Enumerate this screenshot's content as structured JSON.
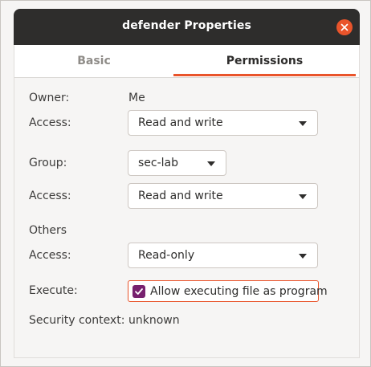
{
  "window": {
    "title": "defender Properties",
    "accent_color": "#e9542b",
    "titlebar_color": "#2e2d2c"
  },
  "tabs": [
    {
      "label": "Basic",
      "active": false
    },
    {
      "label": "Permissions",
      "active": true
    }
  ],
  "owner": {
    "label": "Owner:",
    "value": "Me",
    "access_label": "Access:",
    "access_value": "Read and write"
  },
  "group": {
    "label": "Group:",
    "value": "sec-lab",
    "access_label": "Access:",
    "access_value": "Read and write"
  },
  "others": {
    "heading": "Others",
    "access_label": "Access:",
    "access_value": "Read-only"
  },
  "execute": {
    "label": "Execute:",
    "checkbox_label": "Allow executing file as program",
    "checked": true,
    "check_color": "#77216f"
  },
  "security": {
    "label": "Security context:",
    "value": "unknown"
  },
  "icons": {
    "close": "close-icon",
    "dropdown": "chevron-down-icon",
    "check": "checkmark-icon"
  }
}
